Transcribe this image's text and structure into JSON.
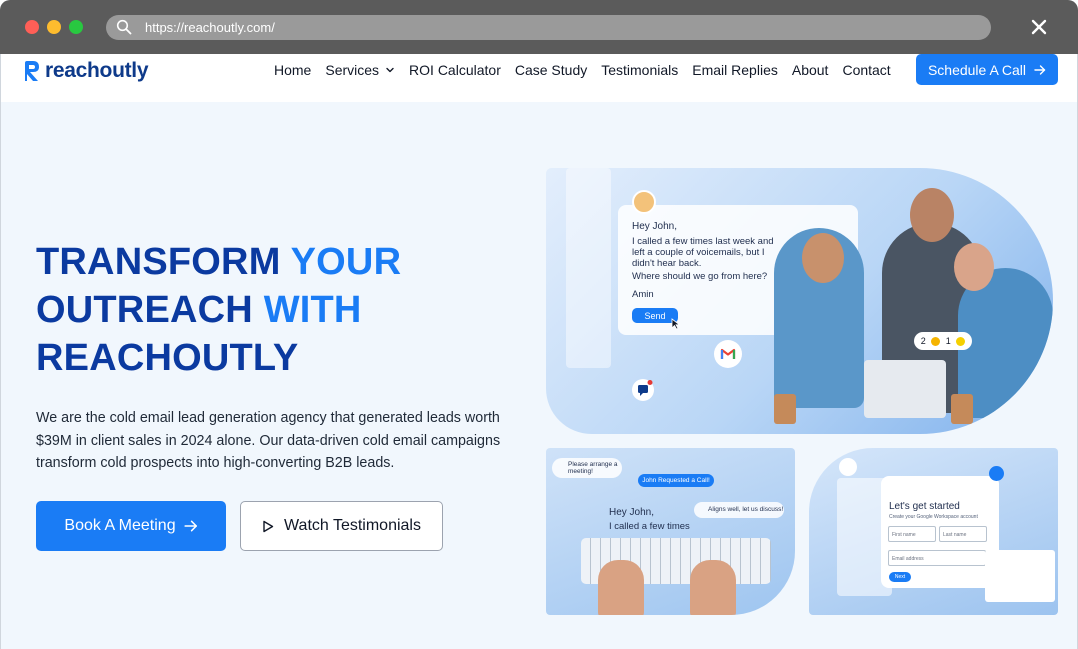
{
  "browser": {
    "url": "https://reachoutly.com/"
  },
  "brand": {
    "name": "reachoutly",
    "primary_color": "#1a7cf5",
    "dark_color": "#0b3aa0"
  },
  "nav": {
    "items": [
      {
        "label": "Home"
      },
      {
        "label": "Services"
      },
      {
        "label": "ROI Calculator"
      },
      {
        "label": "Case Study"
      },
      {
        "label": "Testimonials"
      },
      {
        "label": "Email Replies"
      },
      {
        "label": "About"
      },
      {
        "label": "Contact"
      }
    ],
    "cta_label": "Schedule A Call"
  },
  "hero": {
    "headline_line1_dark": "TRANSFORM ",
    "headline_line1_accent": "YOUR",
    "headline_line2_dark": "OUTREACH ",
    "headline_line2_accent": "WITH",
    "headline_line3": "REACHOUTLY",
    "subtext": "We are the cold email lead generation agency that generated leads worth $39M in client sales in 2024 alone. Our data-driven cold email campaigns transform cold prospects into high-converting B2B leads.",
    "primary_button": "Book A Meeting",
    "secondary_button": "Watch Testimonials"
  },
  "images": {
    "main_email": {
      "greeting": "Hey John,",
      "line1": "I called a few times last week and",
      "line2": "left a couple of voicemails, but I",
      "line3": "didn't hear back.",
      "line4": "Where should we go from here?",
      "signature": "Amin",
      "send": "Send",
      "reaction1": "2",
      "reaction2": "1"
    },
    "left_panel": {
      "bubble1": "Please arrange a meeting!",
      "bubble2": "John Requested a Call!",
      "bubble3": "Aligns well, let us discuss!",
      "email_line1": "Hey John,",
      "email_line2": "I called a few times"
    },
    "right_panel": {
      "title": "Let's get started",
      "subtitle": "Create your Google Workspace account",
      "first_name": "First name",
      "last_name": "Last name",
      "email": "Email address",
      "next": "Next"
    }
  }
}
